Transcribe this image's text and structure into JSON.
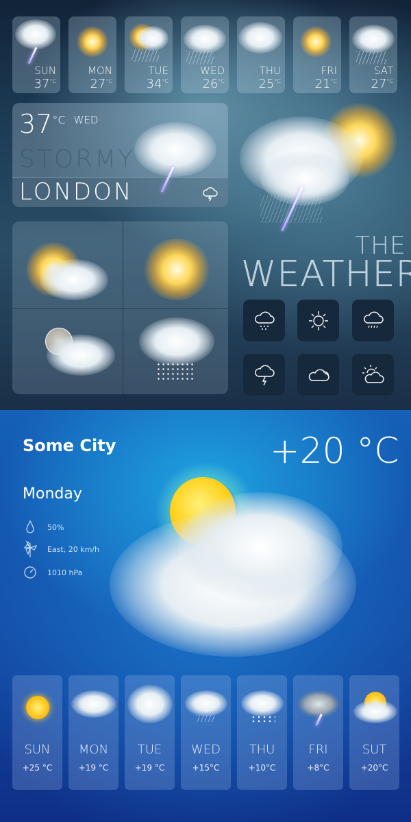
{
  "top_forecast": [
    {
      "day": "SUN",
      "temp": "37",
      "unit": "°C",
      "icon": "thunderstorm-icon"
    },
    {
      "day": "MON",
      "temp": "27",
      "unit": "°C",
      "icon": "sun-icon"
    },
    {
      "day": "TUE",
      "temp": "34",
      "unit": "°C",
      "icon": "sun-cloud-rain-icon"
    },
    {
      "day": "WED",
      "temp": "26",
      "unit": "°C",
      "icon": "rain-icon"
    },
    {
      "day": "THU",
      "temp": "25",
      "unit": "°C",
      "icon": "cloud-icon"
    },
    {
      "day": "FRI",
      "temp": "21",
      "unit": "°C",
      "icon": "sun-icon"
    },
    {
      "day": "SAT",
      "temp": "27",
      "unit": "°C",
      "icon": "rain-icon"
    }
  ],
  "main_panel": {
    "temp": "37",
    "unit": "°C",
    "day": "WED",
    "condition": "STORMY",
    "city": "LONDON"
  },
  "title": {
    "line1": "THE",
    "line2": "WEATHER"
  },
  "icon_buttons": [
    "snow-cloud-icon",
    "sun-icon",
    "drizzle-cloud-icon",
    "lightning-cloud-icon",
    "cloud-icon",
    "partly-cloudy-icon"
  ],
  "current": {
    "city": "Some City",
    "temp": "+20 °C",
    "day": "Monday",
    "humidity": "50%",
    "wind": "East, 20 km/h",
    "pressure": "1010 hPa"
  },
  "bottom_forecast": [
    {
      "day": "SUN",
      "temp": "+25 °C"
    },
    {
      "day": "MON",
      "temp": "+19 °C"
    },
    {
      "day": "TUE",
      "temp": "+19 °C"
    },
    {
      "day": "WED",
      "temp": "+15°C"
    },
    {
      "day": "THU",
      "temp": "+10°C"
    },
    {
      "day": "FRI",
      "temp": "+8°C"
    },
    {
      "day": "SUT",
      "temp": "+20°C"
    }
  ]
}
